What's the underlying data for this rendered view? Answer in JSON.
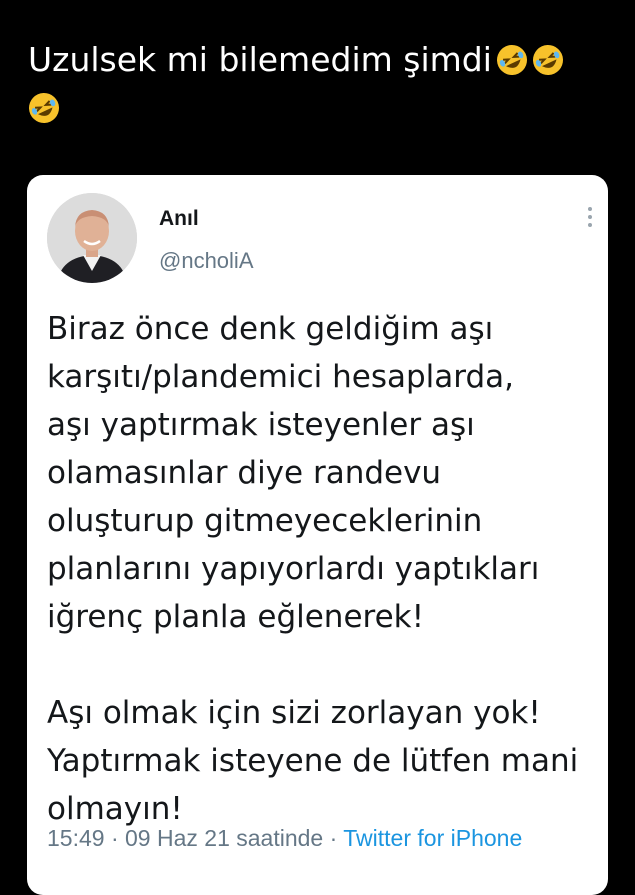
{
  "post": {
    "caption": "Uzulsek mi bilemedim şimdi",
    "caption_emoji": "rolling-on-the-floor-laughing-icon"
  },
  "tweet": {
    "name": "Anıl",
    "handle": "@ncholiA",
    "body_lines": [
      "Biraz önce denk geldiğim aşı",
      "karşıtı/plandemici hesaplarda,",
      "aşı yaptırmak isteyenler aşı",
      "olamasınlar diye randevu",
      "oluşturup gitmeyeceklerinin",
      "planlarını yapıyorlardı yaptıkları",
      "iğrenç planla eğlenerek!",
      "",
      "Aşı olmak için sizi zorlayan yok!",
      "Yaptırmak isteyene de lütfen mani",
      "olmayın!"
    ],
    "time": "15:49",
    "date": "09 Haz 21 saatinde",
    "source": "Twitter for iPhone",
    "separator": "·",
    "accent_color": "#1b95e0",
    "text_color": "#14171a",
    "secondary_color": "#657786"
  }
}
